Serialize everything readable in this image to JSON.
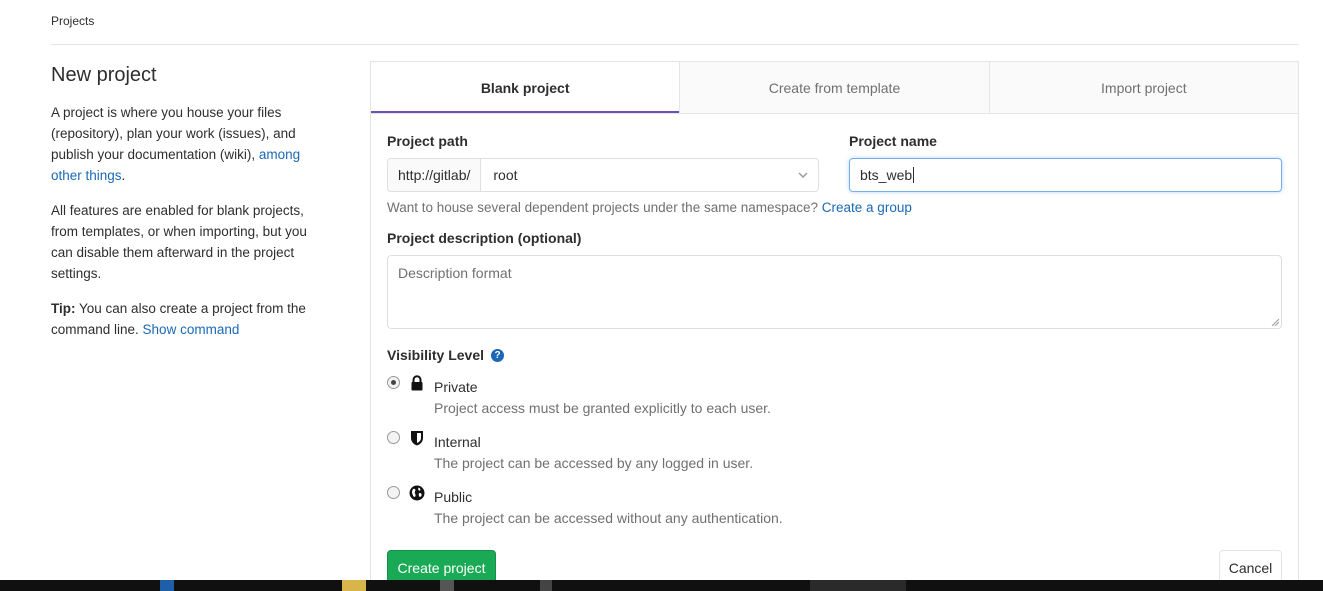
{
  "breadcrumb": "Projects",
  "intro": {
    "title": "New project",
    "para1_text": "A project is where you house your files (repository), plan your work (issues), and publish your documentation (wiki), ",
    "para1_link": "among other things",
    "para1_end": ".",
    "para2": "All features are enabled for blank projects, from templates, or when importing, but you can disable them afterward in the project settings.",
    "tip_label": "Tip:",
    "tip_text": " You can also create a project from the command line. ",
    "tip_link": "Show command"
  },
  "tabs": [
    {
      "label": "Blank project",
      "active": true
    },
    {
      "label": "Create from template",
      "active": false
    },
    {
      "label": "Import project",
      "active": false
    }
  ],
  "form": {
    "path_label": "Project path",
    "path_prefix": "http://gitlab/",
    "namespace": "root",
    "name_label": "Project name",
    "name_value": "bts_web",
    "hint_text": "Want to house several dependent projects under the same namespace? ",
    "hint_link": "Create a group",
    "description_label": "Project description (optional)",
    "description_placeholder": "Description format",
    "visibility_label": "Visibility Level",
    "visibility_options": [
      {
        "title": "Private",
        "description": "Project access must be granted explicitly to each user.",
        "icon": "lock-icon",
        "checked": true
      },
      {
        "title": "Internal",
        "description": "The project can be accessed by any logged in user.",
        "icon": "shield-icon",
        "checked": false
      },
      {
        "title": "Public",
        "description": "The project can be accessed without any authentication.",
        "icon": "globe-icon",
        "checked": false
      }
    ],
    "create_label": "Create project",
    "cancel_label": "Cancel"
  },
  "colors": {
    "accent": "#6b4fbb",
    "link": "#1b69b6",
    "create_button": "#1aaa55",
    "focus_border": "#73afea"
  }
}
